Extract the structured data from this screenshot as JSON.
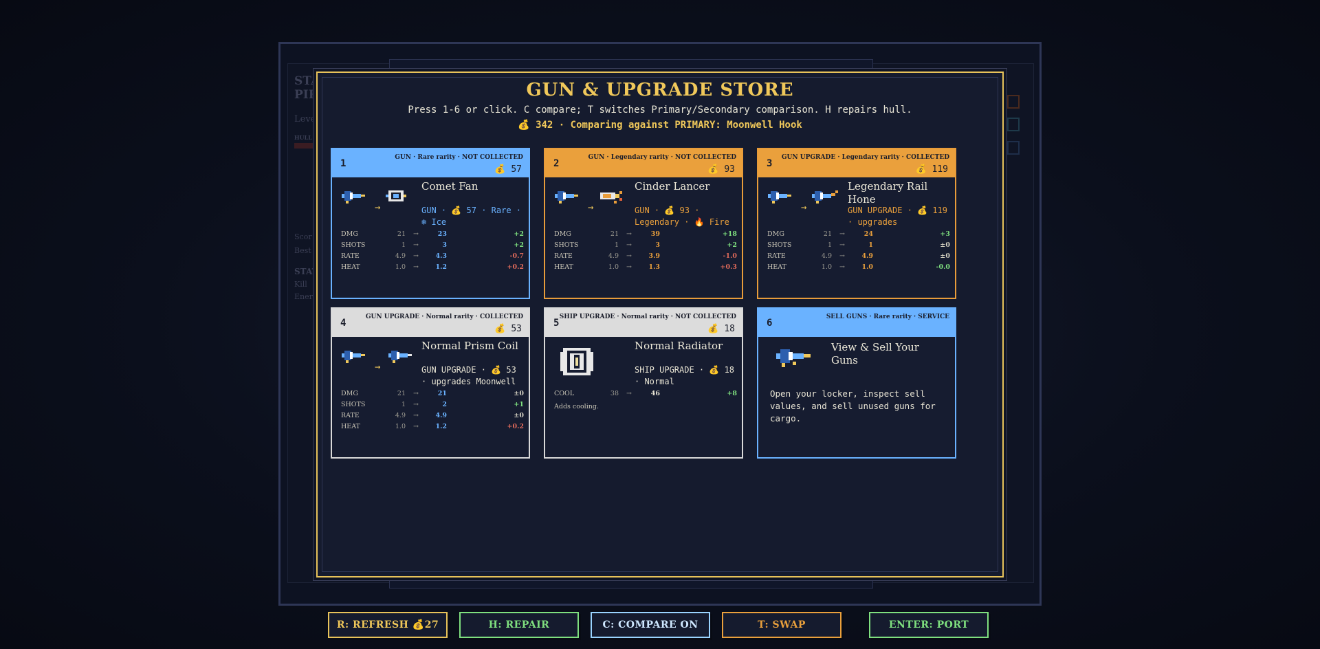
{
  "background": {
    "ghost_title_1": "STA",
    "ghost_title_2": "PIR",
    "ghost_level": "Leve",
    "ghost_hull": "HULL",
    "ghost_score": "Scor",
    "ghost_best": "Best",
    "ghost_stat": "STAT",
    "ghost_kills": "Kill",
    "ghost_energy": "Ener"
  },
  "store": {
    "title": "GUN & UPGRADE STORE",
    "subtitle": "Press 1-6 or click. C compare; T switches Primary/Secondary comparison. H repairs hull.",
    "coin_icon": "money-bag-icon",
    "money": "342",
    "compare_text": "· Comparing against PRIMARY: Moonwell Hook"
  },
  "cards": [
    {
      "number": "1",
      "meta": "GUN · Rare rarity · NOT COLLECTED",
      "price": "57",
      "name": "Comet Fan",
      "desc_1": "GUN · ",
      "desc_price": "57",
      "desc_2": " · Rare · ",
      "desc_3": "Ice",
      "stats": [
        {
          "name": "DMG",
          "old": "21",
          "arrow": "→",
          "new": "23",
          "diff": "+2"
        },
        {
          "name": "SHOTS",
          "old": "1",
          "arrow": "→",
          "new": "3",
          "diff": "+2"
        },
        {
          "name": "RATE",
          "old": "4.9",
          "arrow": "→",
          "new": "4.3",
          "diff": "-0.7"
        },
        {
          "name": "HEAT",
          "old": "1.0",
          "arrow": "→",
          "new": "1.2",
          "diff": "+0.2"
        }
      ]
    },
    {
      "number": "2",
      "meta": "GUN · Legendary rarity · NOT COLLECTED",
      "price": "93",
      "name": "Cinder Lancer",
      "desc_1": "GUN · ",
      "desc_price": "93",
      "desc_2": " · Legendary · ",
      "desc_3": "Fire",
      "stats": [
        {
          "name": "DMG",
          "old": "21",
          "arrow": "→",
          "new": "39",
          "diff": "+18"
        },
        {
          "name": "SHOTS",
          "old": "1",
          "arrow": "→",
          "new": "3",
          "diff": "+2"
        },
        {
          "name": "RATE",
          "old": "4.9",
          "arrow": "→",
          "new": "3.9",
          "diff": "-1.0"
        },
        {
          "name": "HEAT",
          "old": "1.0",
          "arrow": "→",
          "new": "1.3",
          "diff": "+0.3"
        }
      ]
    },
    {
      "number": "3",
      "meta": "GUN UPGRADE · Legendary rarity · COLLECTED",
      "price": "119",
      "name": "Legendary Rail Hone",
      "desc_1": "GUN UPGRADE · ",
      "desc_price": "119",
      "desc_2": " · upgrades",
      "stats": [
        {
          "name": "DMG",
          "old": "21",
          "arrow": "→",
          "new": "24",
          "diff": "+3"
        },
        {
          "name": "SHOTS",
          "old": "1",
          "arrow": "→",
          "new": "1",
          "diff": "±0"
        },
        {
          "name": "RATE",
          "old": "4.9",
          "arrow": "→",
          "new": "4.9",
          "diff": "±0"
        },
        {
          "name": "HEAT",
          "old": "1.0",
          "arrow": "→",
          "new": "1.0",
          "diff": "-0.0"
        }
      ]
    },
    {
      "number": "4",
      "meta": "GUN UPGRADE · Normal rarity · COLLECTED",
      "price": "53",
      "name": "Normal Prism Coil",
      "desc_1": "GUN UPGRADE · ",
      "desc_price": "53",
      "desc_2": " · upgrades Moonwell",
      "stats": [
        {
          "name": "DMG",
          "old": "21",
          "arrow": "→",
          "new": "21",
          "diff": "±0"
        },
        {
          "name": "SHOTS",
          "old": "1",
          "arrow": "→",
          "new": "2",
          "diff": "+1"
        },
        {
          "name": "RATE",
          "old": "4.9",
          "arrow": "→",
          "new": "4.9",
          "diff": "±0"
        },
        {
          "name": "HEAT",
          "old": "1.0",
          "arrow": "→",
          "new": "1.2",
          "diff": "+0.2"
        }
      ]
    },
    {
      "number": "5",
      "meta": "SHIP UPGRADE · Normal rarity · NOT COLLECTED",
      "price": "18",
      "name": "Normal Radiator",
      "desc_1": "SHIP UPGRADE · ",
      "desc_price": "18",
      "desc_2": " · Normal",
      "stats": [
        {
          "name": "COOL",
          "old": "38",
          "arrow": "→",
          "new": "46",
          "diff": "+8"
        }
      ],
      "note": "Adds cooling."
    },
    {
      "number": "6",
      "meta": "SELL GUNS · Rare rarity · SERVICE",
      "name": "View & Sell Your Guns",
      "description": "Open your locker, inspect sell values, and sell unused guns for cargo."
    }
  ],
  "buttons": {
    "refresh": "R: REFRESH",
    "refresh_cost": "27",
    "repair": "H: REPAIR",
    "compare": "C: COMPARE ON",
    "swap": "T: SWAP",
    "port": "ENTER: PORT"
  },
  "colors": {
    "gold": "#f0c85a",
    "blue": "#6ab2ff",
    "orange": "#eaa03c",
    "gray": "#dcdcdc",
    "green": "#7fe07f",
    "red": "#e06a5a"
  }
}
